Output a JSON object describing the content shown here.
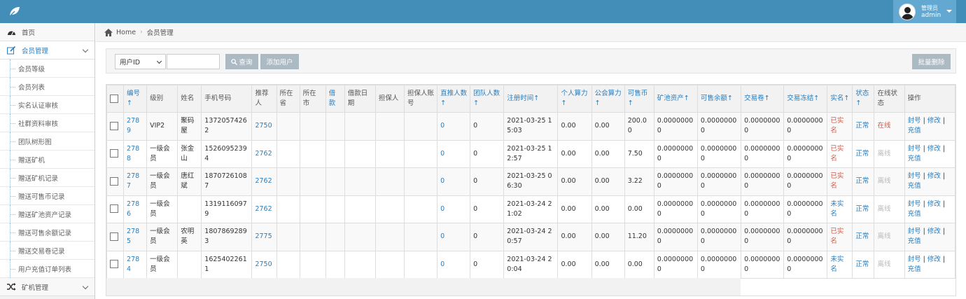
{
  "topbar": {
    "user_role": "管理员",
    "user_name": "admin"
  },
  "sidebar": {
    "items": [
      {
        "label": "首页",
        "icon": "dashboard-icon"
      },
      {
        "label": "会员管理",
        "icon": "edit-icon"
      },
      {
        "label": "矿机管理",
        "icon": "shuffle-icon"
      }
    ],
    "sub_items": [
      "会员等级",
      "会员列表",
      "实名认证审核",
      "社群资料审核",
      "团队树形图",
      "赠送矿机",
      "赠送矿机记录",
      "赠送可售币记录",
      "赠送矿池资产记录",
      "赠送可售余额记录",
      "赠送交易卷记录",
      "用户充值订单列表"
    ]
  },
  "breadcrumb": {
    "home": "Home",
    "current": "会员管理"
  },
  "toolbar": {
    "select_value": "用户ID",
    "search_label": "查询",
    "add_label": "添加用户",
    "batch_delete_label": "批量删除"
  },
  "table": {
    "headers": [
      "编号↑",
      "级别",
      "姓名",
      "手机号码",
      "推荐人",
      "所在省",
      "所在市",
      "借款",
      "借款日期",
      "担保人",
      "担保人账号",
      "直推人数↑",
      "团队人数↑",
      "注册时间↑",
      "个人算力↑",
      "公会算力↑",
      "可售币↑",
      "矿池资产↑",
      "可售余额↑",
      "交易卷↑",
      "交易冻结↑",
      "实名↑",
      "状态↑",
      "在线状态",
      "操作"
    ],
    "rows": [
      {
        "id": "2789",
        "level": "VIP2",
        "name": "聚码屋",
        "phone": "13720574262",
        "ref": "2750",
        "prov": "",
        "city": "",
        "loan": "",
        "loan_date": "",
        "guar": "",
        "guar_acc": "",
        "direct": "0",
        "team": "0",
        "reg": "2021-03-25 15:03",
        "power": "0.00",
        "guild": "0.00",
        "coin": "200.00",
        "pool": "0.00000000",
        "bal": "0.00000000",
        "vol": "0.00000000",
        "frozen": "0.00000000",
        "verify": "已实名",
        "status": "正常",
        "online": "在线",
        "act_ban": "封号",
        "act_edit": "修改",
        "act_charge": "充值"
      },
      {
        "id": "2788",
        "level": "一级会员",
        "name": "张金山",
        "phone": "15260952394",
        "ref": "2762",
        "prov": "",
        "city": "",
        "loan": "",
        "loan_date": "",
        "guar": "",
        "guar_acc": "",
        "direct": "0",
        "team": "0",
        "reg": "2021-03-25 12:57",
        "power": "0.00",
        "guild": "0.00",
        "coin": "7.50",
        "pool": "0.00000000",
        "bal": "0.00000000",
        "vol": "0.00000000",
        "frozen": "0.00000000",
        "verify": "已实名",
        "status": "正常",
        "online": "离线",
        "act_ban": "封号",
        "act_edit": "修改",
        "act_charge": "充值"
      },
      {
        "id": "2787",
        "level": "一级会员",
        "name": "唐红斌",
        "phone": "18707261087",
        "ref": "2762",
        "prov": "",
        "city": "",
        "loan": "",
        "loan_date": "",
        "guar": "",
        "guar_acc": "",
        "direct": "0",
        "team": "0",
        "reg": "2021-03-25 06:30",
        "power": "0.00",
        "guild": "0.00",
        "coin": "3.22",
        "pool": "0.00000000",
        "bal": "0.00000000",
        "vol": "0.00000000",
        "frozen": "0.00000000",
        "verify": "已实名",
        "status": "正常",
        "online": "离线",
        "act_ban": "封号",
        "act_edit": "修改",
        "act_charge": "充值"
      },
      {
        "id": "2786",
        "level": "一级会员",
        "name": "",
        "phone": "13191160979",
        "ref": "2762",
        "prov": "",
        "city": "",
        "loan": "",
        "loan_date": "",
        "guar": "",
        "guar_acc": "",
        "direct": "0",
        "team": "0",
        "reg": "2021-03-24 21:02",
        "power": "0.00",
        "guild": "0.00",
        "coin": "0.00",
        "pool": "0.00000000",
        "bal": "0.00000000",
        "vol": "0.00000000",
        "frozen": "0.00000000",
        "verify": "未实名",
        "status": "正常",
        "online": "离线",
        "act_ban": "封号",
        "act_edit": "修改",
        "act_charge": "充值"
      },
      {
        "id": "2785",
        "level": "一级会员",
        "name": "农明英",
        "phone": "18078692893",
        "ref": "2775",
        "prov": "",
        "city": "",
        "loan": "",
        "loan_date": "",
        "guar": "",
        "guar_acc": "",
        "direct": "0",
        "team": "0",
        "reg": "2021-03-24 20:57",
        "power": "0.00",
        "guild": "0.00",
        "coin": "11.20",
        "pool": "0.00000000",
        "bal": "0.00000000",
        "vol": "0.00000000",
        "frozen": "0.00000000",
        "verify": "已实名",
        "status": "正常",
        "online": "离线",
        "act_ban": "封号",
        "act_edit": "修改",
        "act_charge": "充值"
      },
      {
        "id": "2784",
        "level": "一级会员",
        "name": "",
        "phone": "16254022611",
        "ref": "2750",
        "prov": "",
        "city": "",
        "loan": "",
        "loan_date": "",
        "guar": "",
        "guar_acc": "",
        "direct": "0",
        "team": "0",
        "reg": "2021-03-24 20:04",
        "power": "0.00",
        "guild": "0.00",
        "coin": "0.00",
        "pool": "0.00000000",
        "bal": "0.00000000",
        "vol": "0.00000000",
        "frozen": "0.00000000",
        "verify": "未实名",
        "status": "正常",
        "online": "离线",
        "act_ban": "封号",
        "act_edit": "修改",
        "act_charge": "充值"
      }
    ]
  },
  "colors": {
    "brand": "#438eb9",
    "link": "#2b7dbc",
    "danger": "#d15b47",
    "muted": "#bbbbbb",
    "button": "#abbac3"
  }
}
